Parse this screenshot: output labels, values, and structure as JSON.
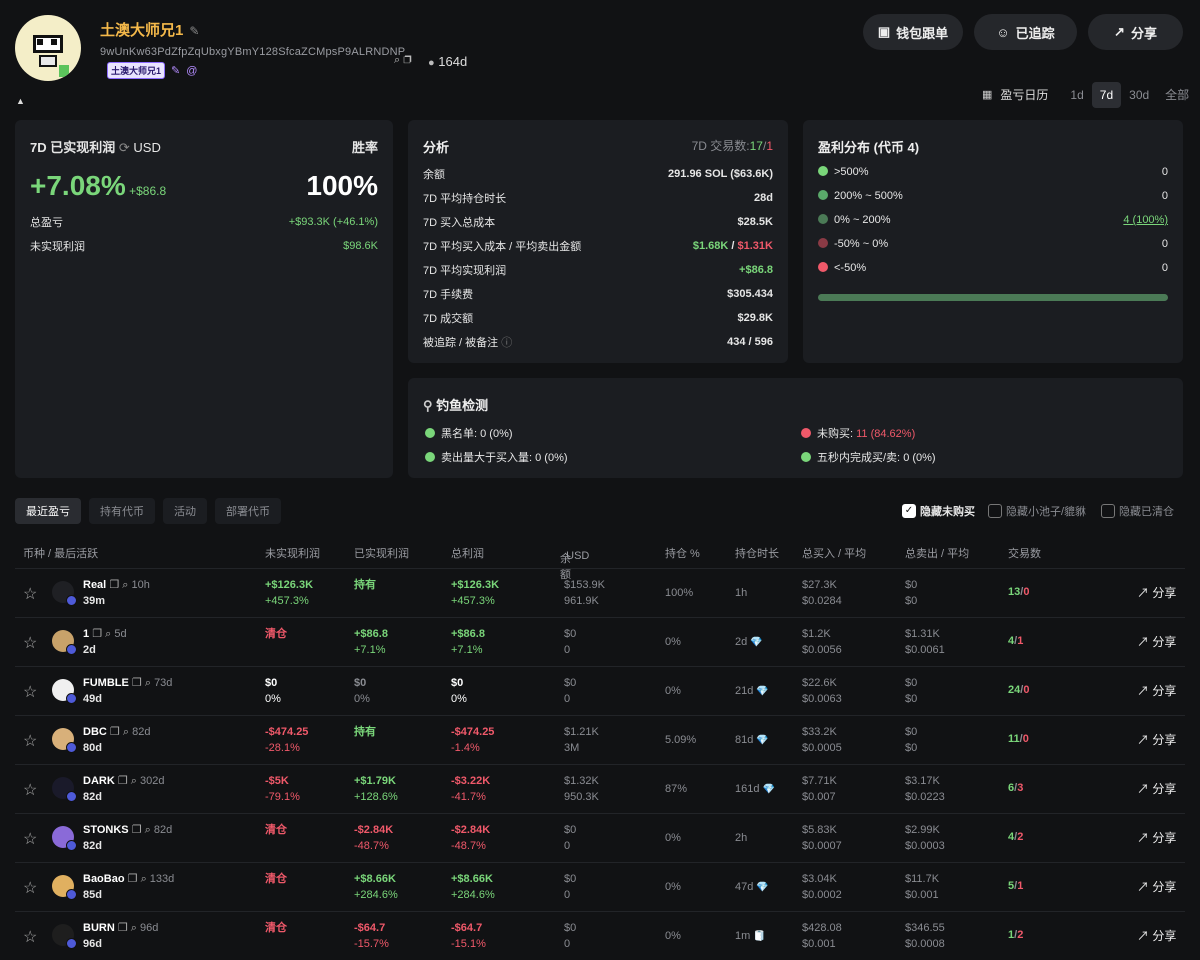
{
  "profile": {
    "name": "土澳大师兄1",
    "address": "9wUnKw63PdZfpZqUbxgYBmY128SfcaZCMpsP9ALRNDNP",
    "days": "164d",
    "tag": "土澳大师兄1"
  },
  "buttons": {
    "copy_trade": "钱包跟单",
    "following": "已追踪",
    "share": "分享"
  },
  "timeframe": {
    "calendar_label": "盈亏日历",
    "options": [
      "1d",
      "7d",
      "30d",
      "全部"
    ],
    "selected": "7d"
  },
  "realized": {
    "title": "7D 已实现利润",
    "currency": "USD",
    "winrate_label": "胜率",
    "pct": "+7.08%",
    "amount": "+$86.8",
    "winrate": "100%",
    "total_pnl_label": "总盈亏",
    "total_pnl": "+$93.3K (+46.1%)",
    "unrealized_label": "未实现利润",
    "unrealized": "$98.6K"
  },
  "analysis": {
    "title": "分析",
    "tx_label": "7D 交易数:",
    "tx_buy": "17",
    "tx_sep": "/",
    "tx_sell": "1",
    "balance_label": "余额",
    "balance": "291.96 SOL ($63.6K)",
    "hold_label": "7D 平均持仓时长",
    "hold": "28d",
    "cost_label": "7D 买入总成本",
    "cost": "$28.5K",
    "avg_label": "7D 平均买入成本 / 平均卖出金额",
    "avg_buy": "$1.68K",
    "avg_sep": " / ",
    "avg_sell": "$1.31K",
    "avgprofit_label": "7D 平均实现利润",
    "avgprofit": "+$86.8",
    "fee_label": "7D 手续费",
    "fee": "$305.434",
    "volume_label": "7D 成交额",
    "volume": "$29.8K",
    "follow_label": "被追踪 / 被备注",
    "follow": "434 / 596"
  },
  "distribution": {
    "title": "盈利分布 (代币 4)",
    "items": [
      {
        "label": ">500%",
        "value": "0",
        "color": "#7ad67a"
      },
      {
        "label": "200% ~ 500%",
        "value": "0",
        "color": "#5aa96a"
      },
      {
        "label": "0% ~ 200%",
        "value": "4 (100%)",
        "color": "#4b7a56"
      },
      {
        "label": "-50% ~ 0%",
        "value": "0",
        "color": "#8a3a45"
      },
      {
        "label": "<-50%",
        "value": "0",
        "color": "#f0596a"
      }
    ],
    "bar_color": "#4b7a56"
  },
  "phishing": {
    "title": "钓鱼检测",
    "items": [
      {
        "label": "黑名单:",
        "value": "0 (0%)",
        "color": "#7ad67a"
      },
      {
        "label": "未购买:",
        "value": "11 (84.62%)",
        "color": "#f0596a"
      },
      {
        "label": "卖出量大于买入量:",
        "value": "0 (0%)",
        "color": "#7ad67a"
      },
      {
        "label": "五秒内完成买/卖:",
        "value": "0 (0%)",
        "color": "#7ad67a"
      }
    ]
  },
  "tabs": [
    "最近盈亏",
    "持有代币",
    "活动",
    "部署代币"
  ],
  "filters": [
    "隐藏未购买",
    "隐藏小池子/貔貅",
    "隐藏已清仓"
  ],
  "table": {
    "headers": {
      "token": "币种 / 最后活跃",
      "unrealized": "未实现利润",
      "realized": "已实现利润",
      "total": "总利润",
      "balance": "余额",
      "balance_unit": "USD",
      "position": "持仓 %",
      "duration": "持仓时长",
      "bought": "总买入 / 平均",
      "sold": "总卖出 / 平均",
      "trades": "交易数"
    },
    "share": "分享",
    "rows": [
      {
        "name": "Real",
        "age": "10h",
        "last": "39m",
        "unreal": "+$126.3K",
        "unreal_pct": "+457.3%",
        "unreal_cls": "green",
        "realized": "持有",
        "realized_pct": "",
        "realized_cls": "green",
        "total": "+$126.3K",
        "total_pct": "+457.3%",
        "total_cls": "green",
        "bal_usd": "$153.9K",
        "bal_amt": "961.9K",
        "pos": "100%",
        "dur": "1h",
        "dia": "",
        "buy": "$27.3K",
        "buy_avg": "$0.0284",
        "sell": "$0",
        "sell_avg": "$0",
        "tx_buy": "13",
        "tx_sell": "0"
      },
      {
        "name": "1",
        "age": "5d",
        "last": "2d",
        "unreal": "清仓",
        "unreal_pct": "",
        "unreal_cls": "red",
        "realized": "+$86.8",
        "realized_pct": "+7.1%",
        "realized_cls": "green",
        "total": "+$86.8",
        "total_pct": "+7.1%",
        "total_cls": "green",
        "bal_usd": "$0",
        "bal_amt": "0",
        "pos": "0%",
        "dur": "2d",
        "dia": "💎",
        "buy": "$1.2K",
        "buy_avg": "$0.0056",
        "sell": "$1.31K",
        "sell_avg": "$0.0061",
        "tx_buy": "4",
        "tx_sell": "1"
      },
      {
        "name": "FUMBLE",
        "age": "73d",
        "last": "49d",
        "unreal": "$0",
        "unreal_pct": "0%",
        "unreal_cls": "white",
        "realized": "$0",
        "realized_pct": "0%",
        "realized_cls": "gray",
        "total": "$0",
        "total_pct": "0%",
        "total_cls": "white",
        "bal_usd": "$0",
        "bal_amt": "0",
        "pos": "0%",
        "dur": "21d",
        "dia": "💎",
        "buy": "$22.6K",
        "buy_avg": "$0.0063",
        "sell": "$0",
        "sell_avg": "$0",
        "tx_buy": "24",
        "tx_sell": "0"
      },
      {
        "name": "DBC",
        "age": "82d",
        "last": "80d",
        "unreal": "-$474.25",
        "unreal_pct": "-28.1%",
        "unreal_cls": "red",
        "realized": "持有",
        "realized_pct": "",
        "realized_cls": "green",
        "total": "-$474.25",
        "total_pct": "-1.4%",
        "total_cls": "red",
        "bal_usd": "$1.21K",
        "bal_amt": "3M",
        "pos": "5.09%",
        "dur": "81d",
        "dia": "💎",
        "buy": "$33.2K",
        "buy_avg": "$0.0005",
        "sell": "$0",
        "sell_avg": "$0",
        "tx_buy": "11",
        "tx_sell": "0"
      },
      {
        "name": "DARK",
        "age": "302d",
        "last": "82d",
        "unreal": "-$5K",
        "unreal_pct": "-79.1%",
        "unreal_cls": "red",
        "realized": "+$1.79K",
        "realized_pct": "+128.6%",
        "realized_cls": "green",
        "total": "-$3.22K",
        "total_pct": "-41.7%",
        "total_cls": "red",
        "bal_usd": "$1.32K",
        "bal_amt": "950.3K",
        "pos": "87%",
        "dur": "161d",
        "dia": "💎",
        "buy": "$7.71K",
        "buy_avg": "$0.007",
        "sell": "$3.17K",
        "sell_avg": "$0.0223",
        "tx_buy": "6",
        "tx_sell": "3"
      },
      {
        "name": "STONKS",
        "age": "82d",
        "last": "82d",
        "unreal": "清仓",
        "unreal_pct": "",
        "unreal_cls": "red",
        "realized": "-$2.84K",
        "realized_pct": "-48.7%",
        "realized_cls": "red",
        "total": "-$2.84K",
        "total_pct": "-48.7%",
        "total_cls": "red",
        "bal_usd": "$0",
        "bal_amt": "0",
        "pos": "0%",
        "dur": "2h",
        "dia": "",
        "buy": "$5.83K",
        "buy_avg": "$0.0007",
        "sell": "$2.99K",
        "sell_avg": "$0.0003",
        "tx_buy": "4",
        "tx_sell": "2"
      },
      {
        "name": "BaoBao",
        "age": "133d",
        "last": "85d",
        "unreal": "清仓",
        "unreal_pct": "",
        "unreal_cls": "red",
        "realized": "+$8.66K",
        "realized_pct": "+284.6%",
        "realized_cls": "green",
        "total": "+$8.66K",
        "total_pct": "+284.6%",
        "total_cls": "green",
        "bal_usd": "$0",
        "bal_amt": "0",
        "pos": "0%",
        "dur": "47d",
        "dia": "💎",
        "buy": "$3.04K",
        "buy_avg": "$0.0002",
        "sell": "$11.7K",
        "sell_avg": "$0.001",
        "tx_buy": "5",
        "tx_sell": "1"
      },
      {
        "name": "BURN",
        "age": "96d",
        "last": "96d",
        "unreal": "清仓",
        "unreal_pct": "",
        "unreal_cls": "red",
        "realized": "-$64.7",
        "realized_pct": "-15.7%",
        "realized_cls": "red",
        "total": "-$64.7",
        "total_pct": "-15.1%",
        "total_cls": "red",
        "bal_usd": "$0",
        "bal_amt": "0",
        "pos": "0%",
        "dur": "1m",
        "dia": "🧻",
        "buy": "$428.08",
        "buy_avg": "$0.001",
        "sell": "$346.55",
        "sell_avg": "$0.0008",
        "tx_buy": "1",
        "tx_sell": "2"
      }
    ]
  }
}
